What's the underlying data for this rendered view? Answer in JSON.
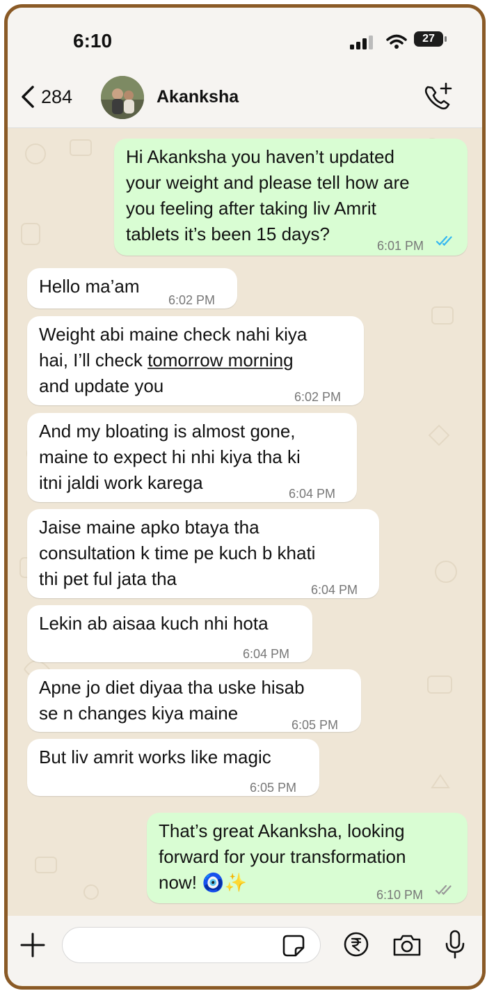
{
  "status_bar": {
    "time": "6:10",
    "battery": "27"
  },
  "header": {
    "back_count": "284",
    "contact_name": "Akanksha",
    "call_icon": "phone-plus-icon"
  },
  "messages": [
    {
      "dir": "out",
      "lines": [
        "Hi Akanksha you haven’t updated",
        "your weight and please tell how are",
        "you feeling after taking liv Amrit",
        "tablets it’s been 15 days?"
      ],
      "time": "6:01 PM",
      "status": "read"
    },
    {
      "dir": "in",
      "lines": [
        "Hello ma’am"
      ],
      "time": "6:02 PM"
    },
    {
      "dir": "in",
      "line1": "Weight abi maine check nahi kiya",
      "line2_pre": "hai, I’ll check ",
      "line2_link": "tomorrow morning",
      "line3": "and update you",
      "time": "6:02 PM"
    },
    {
      "dir": "in",
      "lines": [
        "And my bloating is almost gone,",
        "maine to expect hi nhi kiya tha ki",
        "itni jaldi work karega"
      ],
      "time": "6:04 PM"
    },
    {
      "dir": "in",
      "lines": [
        "Jaise maine apko btaya tha",
        "consultation k time pe kuch b khati",
        "thi pet ful jata tha"
      ],
      "time": "6:04 PM"
    },
    {
      "dir": "in",
      "lines": [
        "Lekin ab aisaa kuch nhi hota"
      ],
      "time": "6:04 PM"
    },
    {
      "dir": "in",
      "lines": [
        "Apne jo diet diyaa tha uske hisab",
        "se n changes kiya maine"
      ],
      "time": "6:05 PM"
    },
    {
      "dir": "in",
      "lines": [
        "But liv amrit works like magic"
      ],
      "time": "6:05 PM"
    },
    {
      "dir": "out",
      "lines": [
        "That’s great Akanksha, looking",
        "forward for your transformation",
        "now! 🧿✨"
      ],
      "time": "6:10 PM",
      "status": "delivered"
    }
  ],
  "colors": {
    "outgoing_bubble": "#d9fdd3",
    "incoming_bubble": "#ffffff",
    "read_ticks": "#34b7f1",
    "frame": "#8a5a26"
  },
  "input_bar": {
    "icons": [
      "plus-icon",
      "sticker-icon",
      "rupee-icon",
      "camera-icon",
      "mic-icon"
    ]
  }
}
